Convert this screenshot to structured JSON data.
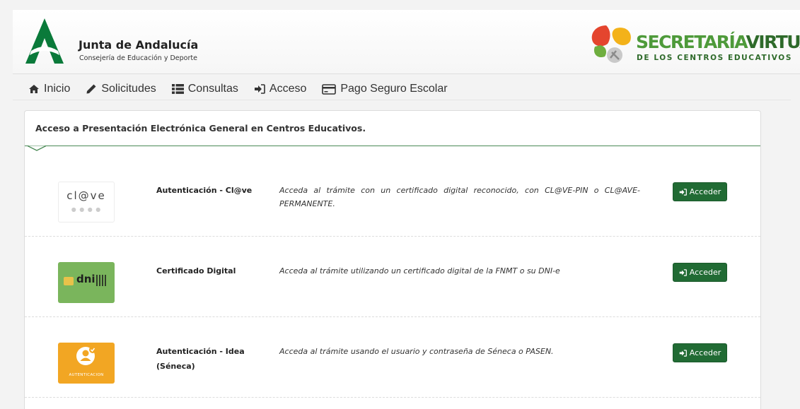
{
  "header": {
    "org_title": "Junta de Andalucía",
    "org_subtitle": "Consejería de Educación y Deporte",
    "brand_word1": "SECRETARÍA",
    "brand_word2": "VIRTUAL",
    "brand_subtitle": "DE LOS CENTROS EDUCATIVOS"
  },
  "nav": {
    "items": [
      {
        "label": "Inicio",
        "icon": "home-icon"
      },
      {
        "label": "Solicitudes",
        "icon": "pencil-icon"
      },
      {
        "label": "Consultas",
        "icon": "list-icon"
      },
      {
        "label": "Acceso",
        "icon": "sign-in-icon"
      },
      {
        "label": "Pago Seguro Escolar",
        "icon": "credit-card-icon"
      }
    ]
  },
  "panel": {
    "title": "Acceso a Presentación Electrónica General en Centros Educativos.",
    "rows": [
      {
        "name": "Autenticación - Cl@ve",
        "logo_text": "cl@ve",
        "description": "Acceda al trámite con un certificado digital reconocido, con CL@VE-PIN o CL@AVE-PERMANENTE.",
        "button": "Acceder"
      },
      {
        "name": "Certificado Digital",
        "logo_text": "dni",
        "description": "Acceda al trámite utilizando un certificado digital de la FNMT o su DNI-e",
        "button": "Acceder"
      },
      {
        "name": "Autenticación - Idea (Séneca)",
        "logo_text": "AUTENTICACION",
        "description": "Acceda al trámite usando el usuario y contraseña de Séneca o PASEN.",
        "button": "Acceder"
      }
    ]
  },
  "colors": {
    "brand_green": "#216b34",
    "accent_green": "#4e9a3a",
    "dni_green": "#7ab55c",
    "idea_orange": "#f2a623"
  }
}
